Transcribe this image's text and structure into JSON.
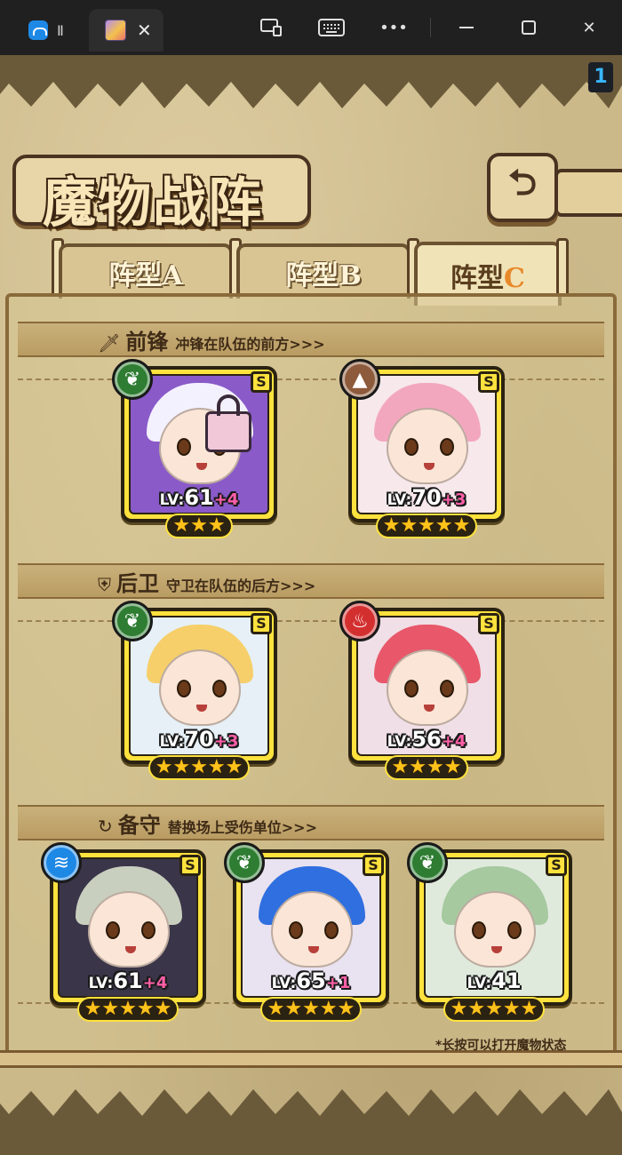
{
  "window": {
    "page_badge": "1"
  },
  "header": {
    "title": "魔物战阵",
    "back_icon": "back-arrow-icon"
  },
  "tabs": [
    {
      "label": "阵型",
      "suffix": "A",
      "active": false
    },
    {
      "label": "阵型",
      "suffix": "B",
      "active": false
    },
    {
      "label": "阵型",
      "suffix": "C",
      "active": true
    }
  ],
  "sections": {
    "vanguard": {
      "icon": "sword-icon",
      "title": "前锋",
      "desc": "冲锋在队伍的前方>>>"
    },
    "rearguard": {
      "icon": "shield-icon",
      "title": "后卫",
      "desc": "守卫在队伍的后方>>>"
    },
    "reserve": {
      "icon": "swap-icon",
      "title": "备守",
      "desc": "替换场上受伤单位>>>"
    }
  },
  "cards": [
    {
      "section": "vanguard",
      "element": "grass",
      "element_color": "#2e7d32",
      "rank": "S",
      "lv_prefix": "LV:",
      "level": "61",
      "bonus": "+4",
      "stars": 3,
      "hair": "#f4f1ff",
      "bg": "#8a5ac8",
      "locked": true
    },
    {
      "section": "vanguard",
      "element": "earth",
      "element_color": "#8d5a3b",
      "rank": "S",
      "lv_prefix": "LV:",
      "level": "70",
      "bonus": "+3",
      "stars": 5,
      "hair": "#f3a7bf",
      "bg": "#f7e8ec",
      "locked": false
    },
    {
      "section": "rearguard",
      "element": "grass",
      "element_color": "#2e7d32",
      "rank": "S",
      "lv_prefix": "LV:",
      "level": "70",
      "bonus": "+3",
      "stars": 5,
      "hair": "#f6cf6a",
      "bg": "#e6f0f6",
      "locked": false
    },
    {
      "section": "rearguard",
      "element": "fire",
      "element_color": "#d32f2f",
      "rank": "S",
      "lv_prefix": "LV:",
      "level": "56",
      "bonus": "+4",
      "stars": 4,
      "hair": "#e8576a",
      "bg": "#f0dfe6",
      "locked": false
    },
    {
      "section": "reserve",
      "element": "water",
      "element_color": "#1e88e5",
      "rank": "S",
      "lv_prefix": "LV:",
      "level": "61",
      "bonus": "+4",
      "stars": 5,
      "hair": "#c9cfbf",
      "bg": "#3a3548",
      "locked": false
    },
    {
      "section": "reserve",
      "element": "grass",
      "element_color": "#2e7d32",
      "rank": "S",
      "lv_prefix": "LV:",
      "level": "65",
      "bonus": "+1",
      "stars": 5,
      "hair": "#2f6fe0",
      "bg": "#e9e2f0",
      "locked": false
    },
    {
      "section": "reserve",
      "element": "grass",
      "element_color": "#2e7d32",
      "rank": "S",
      "lv_prefix": "LV:",
      "level": "41",
      "bonus": "",
      "stars": 5,
      "hair": "#a6c9a0",
      "bg": "#dfeadc",
      "locked": false
    }
  ],
  "footnote": "*长按可以打开魔物状态"
}
